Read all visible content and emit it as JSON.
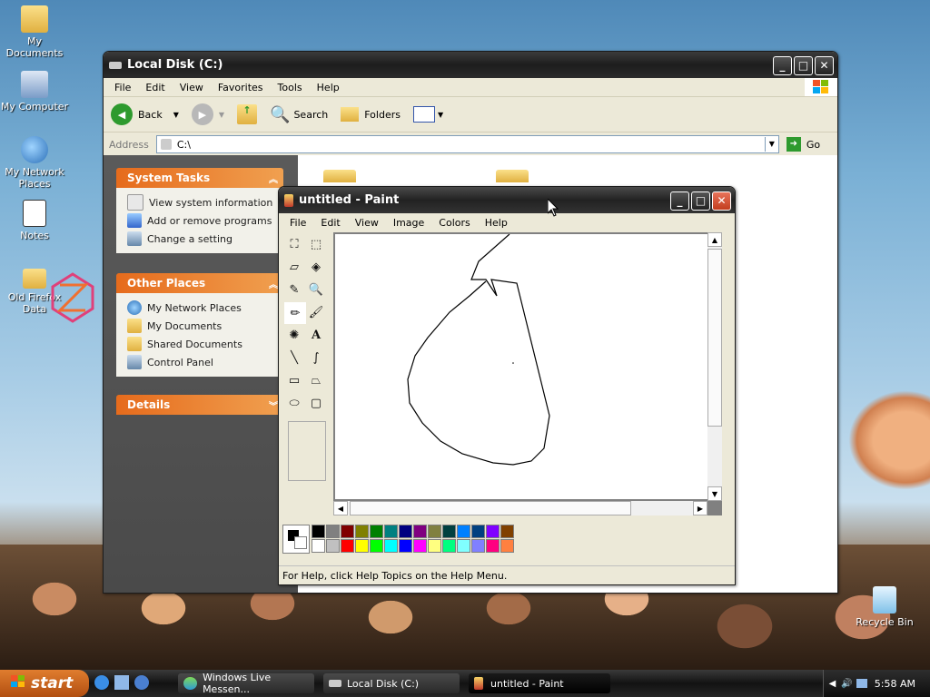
{
  "desktop": {
    "icons": [
      {
        "label": "My Documents"
      },
      {
        "label": "My Computer"
      },
      {
        "label": "My Network Places"
      },
      {
        "label": "Notes"
      },
      {
        "label": "Old Firefox Data"
      },
      {
        "label": "Recycle Bin"
      }
    ]
  },
  "explorer": {
    "title": "Local Disk (C:)",
    "menu": [
      "File",
      "Edit",
      "View",
      "Favorites",
      "Tools",
      "Help"
    ],
    "toolbar": {
      "back": "Back",
      "search": "Search",
      "folders": "Folders"
    },
    "address": {
      "label": "Address",
      "value": "C:\\",
      "go": "Go"
    },
    "system_tasks": {
      "title": "System Tasks",
      "items": [
        "View system information",
        "Add or remove programs",
        "Change a setting"
      ]
    },
    "other_places": {
      "title": "Other Places",
      "items": [
        "My Network Places",
        "My Documents",
        "Shared Documents",
        "Control Panel"
      ]
    },
    "details": {
      "title": "Details"
    }
  },
  "paint": {
    "title": "untitled - Paint",
    "menu": [
      "File",
      "Edit",
      "View",
      "Image",
      "Colors",
      "Help"
    ],
    "status": "For Help, click Help Topics on the Help Menu.",
    "colors": {
      "foreground": "#000000",
      "background": "#ffffff",
      "palette_row1": [
        "#000000",
        "#808080",
        "#800000",
        "#808000",
        "#008000",
        "#008080",
        "#000080",
        "#800080",
        "#808040",
        "#004040",
        "#0080ff",
        "#004080",
        "#8000ff",
        "#804000"
      ],
      "palette_row2": [
        "#ffffff",
        "#c0c0c0",
        "#ff0000",
        "#ffff00",
        "#00ff00",
        "#00ffff",
        "#0000ff",
        "#ff00ff",
        "#ffff80",
        "#00ff80",
        "#80ffff",
        "#8080ff",
        "#ff0080",
        "#ff8040"
      ]
    }
  },
  "taskbar": {
    "start": "start",
    "tasks": [
      "Windows Live Messen...",
      "Local Disk (C:)",
      "untitled - Paint"
    ],
    "clock": "5:58 AM"
  }
}
